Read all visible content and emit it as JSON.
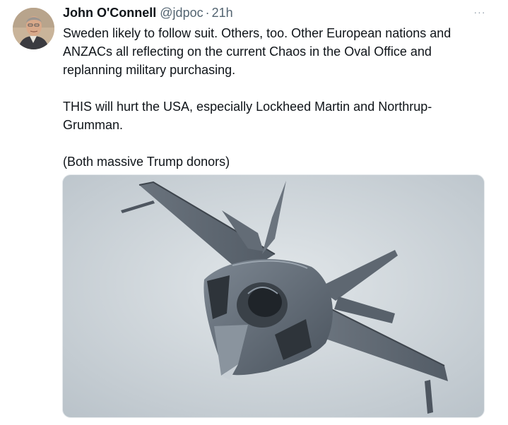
{
  "author": {
    "name": "John O'Connell",
    "handle": "@jdpoc",
    "separator": "·",
    "time": "21h"
  },
  "menu": {
    "more_label": "···"
  },
  "body": {
    "paragraphs": [
      "Sweden likely to follow suit. Others, too. Other European nations and ANZACs all reflecting on the current Chaos in the Oval Office and replanning military purchasing.",
      "THIS will hurt the USA, especially Lockheed Martin and Northrup-Grumman.",
      "(Both massive Trump donors)"
    ]
  },
  "media": {
    "type": "photo",
    "subject": "F-35 fighter jet"
  },
  "colors": {
    "text": "#0f1419",
    "secondary": "#536471",
    "sky": "#ccd3d8",
    "jet": "#5b6570"
  }
}
